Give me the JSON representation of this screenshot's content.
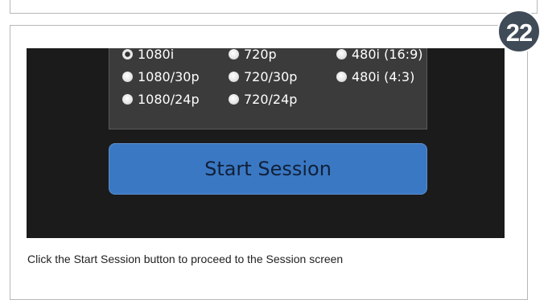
{
  "step": {
    "number": "22"
  },
  "format_panel": {
    "rows": [
      [
        {
          "label": "1080i",
          "selected": true
        },
        {
          "label": "720p",
          "selected": false
        },
        {
          "label": "480i (16:9)",
          "selected": false
        }
      ],
      [
        {
          "label": "1080/30p",
          "selected": false
        },
        {
          "label": "720/30p",
          "selected": false
        },
        {
          "label": "480i (4:3)",
          "selected": false
        }
      ],
      [
        {
          "label": "1080/24p",
          "selected": false
        },
        {
          "label": "720/24p",
          "selected": false
        }
      ]
    ]
  },
  "start_button": {
    "label": "Start Session"
  },
  "caption": {
    "text": "Click the Start Session button to proceed to the Session screen"
  },
  "colors": {
    "badge": "#3f4b57",
    "screen_background": "#1b1b1b",
    "panel_background": "#3b3b3b",
    "button": "#3b78c3"
  }
}
